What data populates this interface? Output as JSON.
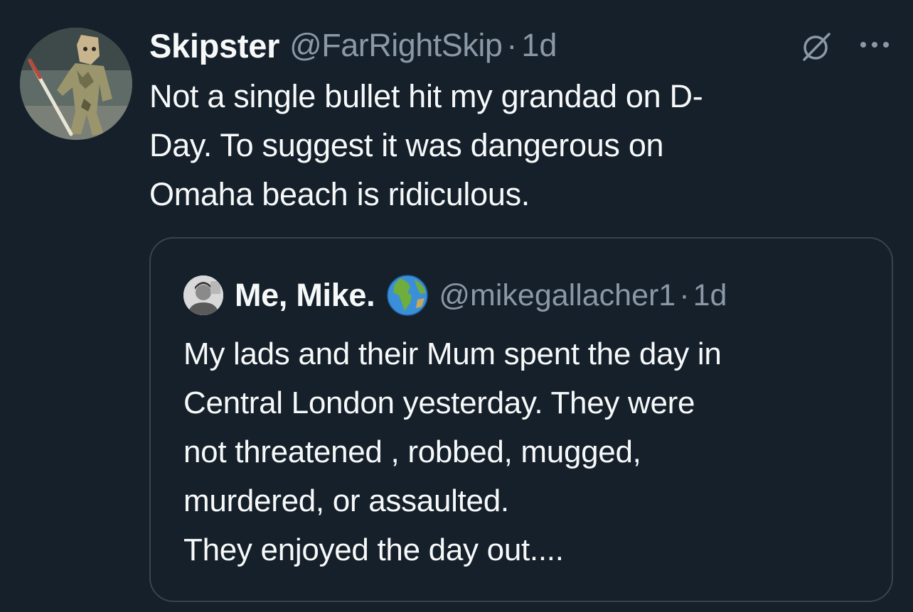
{
  "tweet": {
    "author": {
      "display_name": "Skipster",
      "handle": "@FarRightSkip",
      "avatar_icon": "avatar-figure-icon"
    },
    "separator": "·",
    "time": "1d",
    "icons": {
      "nosign": "nosign-icon",
      "more": "more-options-icon"
    },
    "text_lines": [
      "Not a single bullet hit my grandad on D-",
      "Day. To suggest it was dangerous on",
      "Omaha beach is ridiculous."
    ]
  },
  "quoted_tweet": {
    "author": {
      "display_name": "Me, Mike.",
      "handle": "@mikegallacher1",
      "avatar_icon": "avatar-photo-icon",
      "emoji_icon": "globe-icon"
    },
    "separator": "·",
    "time": "1d",
    "text_lines": [
      "My lads and their Mum spent the day in",
      "Central London yesterday. They were",
      "not threatened , robbed, mugged,",
      "murdered, or assaulted.",
      "They enjoyed the day out...."
    ]
  },
  "colors": {
    "background": "#15202b",
    "text_primary": "#f7f9f9",
    "text_secondary": "#8b98a5",
    "border": "#38444d"
  }
}
